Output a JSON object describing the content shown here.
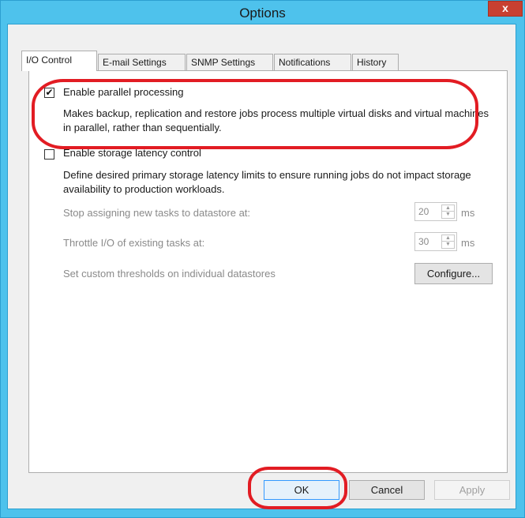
{
  "window": {
    "title": "Options",
    "close_label": "x"
  },
  "tabs": [
    {
      "label": "I/O Control",
      "active": true
    },
    {
      "label": "E-mail Settings",
      "active": false
    },
    {
      "label": "SNMP Settings",
      "active": false
    },
    {
      "label": "Notifications",
      "active": false
    },
    {
      "label": "History",
      "active": false
    }
  ],
  "parallel": {
    "label": "Enable parallel processing",
    "checked": true,
    "check_glyph": "✔",
    "description": "Makes backup, replication and restore jobs process multiple virtual disks and virtual machines in parallel, rather than sequentially."
  },
  "latency": {
    "label": "Enable storage latency control",
    "checked": false,
    "description": "Define desired primary storage latency limits to ensure running jobs do not impact storage availability to production workloads.",
    "stop_label": "Stop assigning new tasks to datastore at:",
    "stop_value": "20",
    "throttle_label": "Throttle I/O of existing tasks at:",
    "throttle_value": "30",
    "unit": "ms",
    "custom_label": "Set custom thresholds on individual datastores",
    "configure_label": "Configure..."
  },
  "footer": {
    "ok_label": "OK",
    "cancel_label": "Cancel",
    "apply_label": "Apply"
  },
  "colors": {
    "window_frame": "#4ec2ec",
    "annotation": "#e21c23",
    "close": "#c84031"
  }
}
